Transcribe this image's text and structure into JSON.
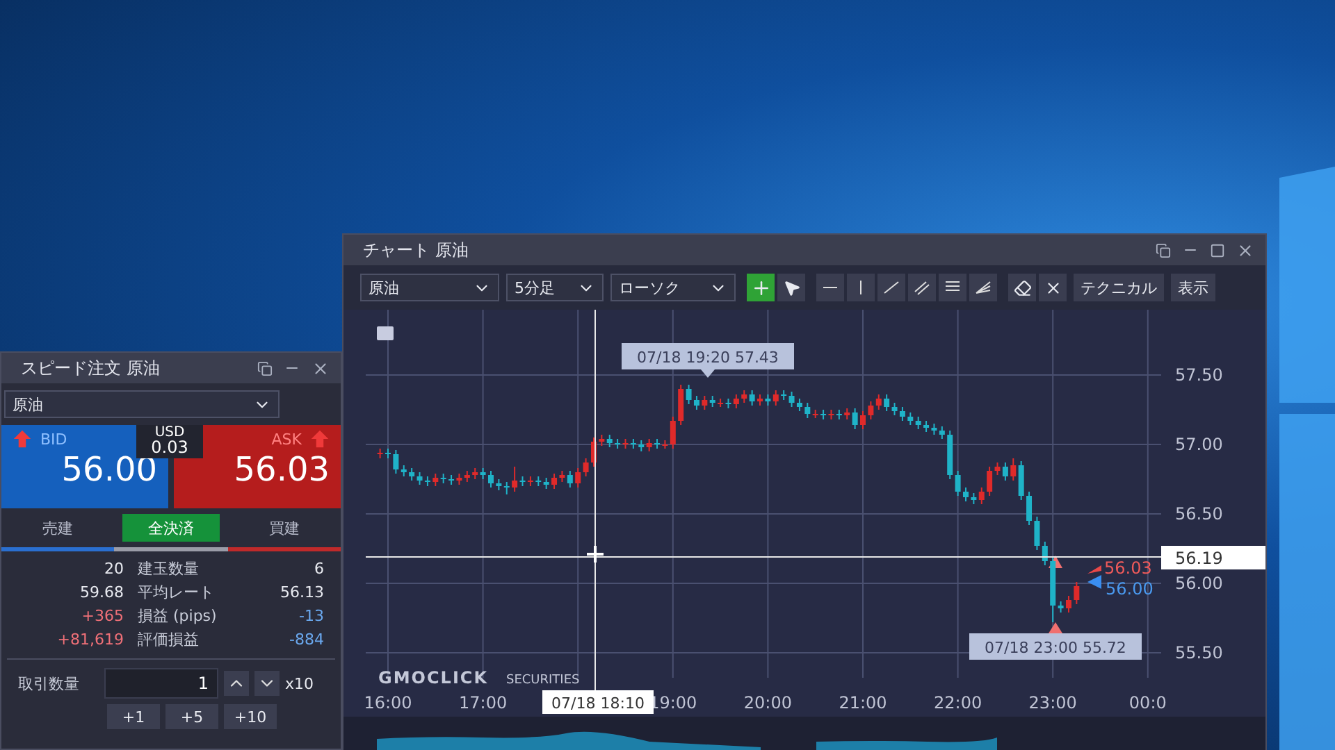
{
  "speed_order": {
    "title": "スピード注文 原油",
    "symbol": "原油",
    "bid": {
      "label": "BID",
      "price": "56.00"
    },
    "spread": {
      "currency": "USD",
      "value": "0.03"
    },
    "ask": {
      "label": "ASK",
      "price": "56.03"
    },
    "tabs": [
      {
        "label": "売建",
        "selected": false
      },
      {
        "label": "全決済",
        "selected": true
      },
      {
        "label": "買建",
        "selected": false
      }
    ],
    "stats": [
      {
        "sell": {
          "text": "20",
          "color": "#e8eaf0"
        },
        "label": "建玉数量",
        "buy": {
          "text": "6",
          "color": "#e8eaf0"
        }
      },
      {
        "sell": {
          "text": "59.68",
          "color": "#e8eaf0"
        },
        "label": "平均レート",
        "buy": {
          "text": "56.13",
          "color": "#e8eaf0"
        }
      },
      {
        "sell": {
          "text": "+365",
          "color": "#f07078"
        },
        "label": "損益 (pips)",
        "buy": {
          "text": "-13",
          "color": "#6aa8ee"
        }
      },
      {
        "sell": {
          "text": "+81,619",
          "color": "#f07078"
        },
        "label": "評価損益",
        "buy": {
          "text": "-884",
          "color": "#6aa8ee"
        }
      }
    ],
    "quantity": {
      "label": "取引数量",
      "value": "1",
      "multiplier": "x10"
    },
    "increments": [
      "+1",
      "+5",
      "+10"
    ]
  },
  "chart_window": {
    "title": "チャート 原油",
    "symbol": "原油",
    "interval": "5分足",
    "chart_type": "ローソク",
    "tools": [
      {
        "kind": "crosshair",
        "selected": true
      },
      {
        "kind": "pointer",
        "selected": false
      }
    ],
    "buttons": [
      "テクニカル",
      "表示"
    ],
    "chart_data": {
      "type": "candlestick",
      "grid": true,
      "ylim": [
        55.32,
        57.97
      ],
      "ref_lines": [
        {
          "axis": "y",
          "value": 56.19,
          "label": "56.19"
        }
      ],
      "yticks": [
        {
          "value": 57.5,
          "label": "57.50"
        },
        {
          "value": 57.0,
          "label": "57.00"
        },
        {
          "value": 56.5,
          "label": "56.50"
        },
        {
          "value": 56.0,
          "label": "56.00"
        },
        {
          "value": 55.5,
          "label": "55.50"
        }
      ],
      "categories": [
        null,
        "16:00",
        null,
        null,
        null,
        null,
        null,
        null,
        null,
        null,
        null,
        null,
        null,
        "17:00",
        null,
        null,
        null,
        null,
        null,
        null,
        null,
        null,
        null,
        null,
        null,
        null,
        null,
        null,
        null,
        null,
        null,
        null,
        null,
        null,
        null,
        null,
        null,
        "19:00",
        null,
        null,
        null,
        null,
        null,
        null,
        null,
        null,
        null,
        null,
        null,
        "20:00",
        null,
        null,
        null,
        null,
        null,
        null,
        null,
        null,
        null,
        null,
        null,
        "21:00",
        null,
        null,
        null,
        null,
        null,
        null,
        null,
        null,
        null,
        null,
        null,
        "22:00",
        null,
        null,
        null,
        null,
        null,
        null,
        null,
        null,
        null,
        null,
        null,
        "23:00",
        null,
        null,
        null,
        null,
        null,
        null,
        null,
        null,
        null,
        null,
        null,
        "00:0"
      ],
      "ohlc": [
        [
          56.93,
          56.97,
          56.9,
          56.94
        ],
        [
          56.94,
          56.97,
          56.9,
          56.93
        ],
        [
          56.93,
          56.96,
          56.79,
          56.82
        ],
        [
          56.82,
          56.85,
          56.77,
          56.8
        ],
        [
          56.8,
          56.83,
          56.74,
          56.77
        ],
        [
          56.77,
          56.8,
          56.71,
          56.74
        ],
        [
          56.74,
          56.77,
          56.7,
          56.73
        ],
        [
          56.73,
          56.79,
          56.7,
          56.76
        ],
        [
          56.76,
          56.79,
          56.72,
          56.75
        ],
        [
          56.75,
          56.78,
          56.71,
          56.74
        ],
        [
          56.74,
          56.79,
          56.71,
          56.76
        ],
        [
          56.76,
          56.81,
          56.73,
          56.78
        ],
        [
          56.78,
          56.83,
          56.75,
          56.8
        ],
        [
          56.8,
          56.83,
          56.75,
          56.78
        ],
        [
          56.78,
          56.81,
          56.69,
          56.72
        ],
        [
          56.72,
          56.75,
          56.67,
          56.7
        ],
        [
          56.7,
          56.73,
          56.64,
          56.69
        ],
        [
          56.69,
          56.84,
          56.66,
          56.74
        ],
        [
          56.74,
          56.77,
          56.7,
          56.73
        ],
        [
          56.73,
          56.77,
          56.7,
          56.74
        ],
        [
          56.74,
          56.77,
          56.7,
          56.73
        ],
        [
          56.73,
          56.76,
          56.68,
          56.71
        ],
        [
          56.71,
          56.79,
          56.68,
          56.76
        ],
        [
          56.76,
          56.81,
          56.73,
          56.78
        ],
        [
          56.78,
          56.81,
          56.69,
          56.72
        ],
        [
          56.72,
          56.83,
          56.69,
          56.8
        ],
        [
          56.8,
          56.9,
          56.77,
          56.87
        ],
        [
          56.87,
          57.05,
          56.84,
          57.02
        ],
        [
          57.02,
          57.07,
          56.99,
          57.04
        ],
        [
          57.04,
          57.07,
          56.98,
          57.01
        ],
        [
          57.01,
          57.04,
          56.97,
          57.0
        ],
        [
          57.0,
          57.04,
          56.97,
          57.01
        ],
        [
          57.01,
          57.04,
          56.97,
          57.0
        ],
        [
          57.0,
          57.03,
          56.95,
          56.98
        ],
        [
          56.98,
          57.04,
          56.95,
          57.01
        ],
        [
          57.01,
          57.04,
          56.97,
          57.0
        ],
        [
          57.0,
          57.03,
          56.97,
          57.0
        ],
        [
          57.0,
          57.2,
          56.97,
          57.17
        ],
        [
          57.17,
          57.43,
          57.14,
          57.4
        ],
        [
          57.4,
          57.43,
          57.29,
          57.32
        ],
        [
          57.32,
          57.35,
          57.25,
          57.28
        ],
        [
          57.28,
          57.35,
          57.25,
          57.32
        ],
        [
          57.32,
          57.35,
          57.27,
          57.3
        ],
        [
          57.3,
          57.33,
          57.27,
          57.3
        ],
        [
          57.3,
          57.33,
          57.26,
          57.29
        ],
        [
          57.29,
          57.36,
          57.26,
          57.33
        ],
        [
          57.33,
          57.39,
          57.3,
          57.36
        ],
        [
          57.36,
          57.39,
          57.28,
          57.31
        ],
        [
          57.31,
          57.36,
          57.28,
          57.33
        ],
        [
          57.33,
          57.36,
          57.28,
          57.31
        ],
        [
          57.31,
          57.39,
          57.28,
          57.36
        ],
        [
          57.36,
          57.39,
          57.32,
          57.35
        ],
        [
          57.35,
          57.38,
          57.27,
          57.3
        ],
        [
          57.3,
          57.33,
          57.24,
          57.27
        ],
        [
          57.27,
          57.3,
          57.19,
          57.22
        ],
        [
          57.22,
          57.25,
          57.19,
          57.22
        ],
        [
          57.22,
          57.25,
          57.18,
          57.21
        ],
        [
          57.21,
          57.25,
          57.18,
          57.22
        ],
        [
          57.22,
          57.25,
          57.18,
          57.21
        ],
        [
          57.21,
          57.26,
          57.18,
          57.23
        ],
        [
          57.23,
          57.26,
          57.11,
          57.14
        ],
        [
          57.14,
          57.24,
          57.11,
          57.21
        ],
        [
          57.21,
          57.31,
          57.18,
          57.28
        ],
        [
          57.28,
          57.36,
          57.25,
          57.33
        ],
        [
          57.33,
          57.36,
          57.24,
          57.27
        ],
        [
          57.27,
          57.3,
          57.21,
          57.24
        ],
        [
          57.24,
          57.27,
          57.17,
          57.2
        ],
        [
          57.2,
          57.23,
          57.14,
          57.17
        ],
        [
          57.17,
          57.2,
          57.11,
          57.14
        ],
        [
          57.14,
          57.17,
          57.09,
          57.12
        ],
        [
          57.12,
          57.15,
          57.07,
          57.1
        ],
        [
          57.1,
          57.13,
          57.04,
          57.07
        ],
        [
          57.07,
          57.1,
          56.75,
          56.78
        ],
        [
          56.78,
          56.81,
          56.63,
          56.66
        ],
        [
          56.66,
          56.69,
          56.59,
          56.62
        ],
        [
          56.62,
          56.65,
          56.57,
          56.6
        ],
        [
          56.6,
          56.69,
          56.57,
          56.66
        ],
        [
          56.66,
          56.84,
          56.63,
          56.81
        ],
        [
          56.81,
          56.87,
          56.78,
          56.84
        ],
        [
          56.84,
          56.87,
          56.74,
          56.77
        ],
        [
          56.77,
          56.9,
          56.74,
          56.85
        ],
        [
          56.85,
          56.88,
          56.6,
          56.63
        ],
        [
          56.63,
          56.66,
          56.42,
          56.45
        ],
        [
          56.45,
          56.48,
          56.24,
          56.27
        ],
        [
          56.27,
          56.3,
          56.13,
          56.16
        ],
        [
          56.16,
          56.19,
          55.72,
          55.84
        ],
        [
          55.84,
          55.87,
          55.79,
          55.82
        ],
        [
          55.82,
          55.91,
          55.79,
          55.88
        ],
        [
          55.88,
          56.01,
          55.85,
          55.98
        ],
        null,
        null,
        null,
        null,
        null,
        null,
        null,
        null,
        null
      ]
    },
    "high_label": "07/18 19:20 57.43",
    "low_label": "07/18 23:00 55.72",
    "crosshair_time": "07/18 18:10",
    "ask_marker": "56.03",
    "bid_marker": "56.00",
    "logo": "GMOCLICK",
    "logo_suffix": "SECURITIES"
  }
}
